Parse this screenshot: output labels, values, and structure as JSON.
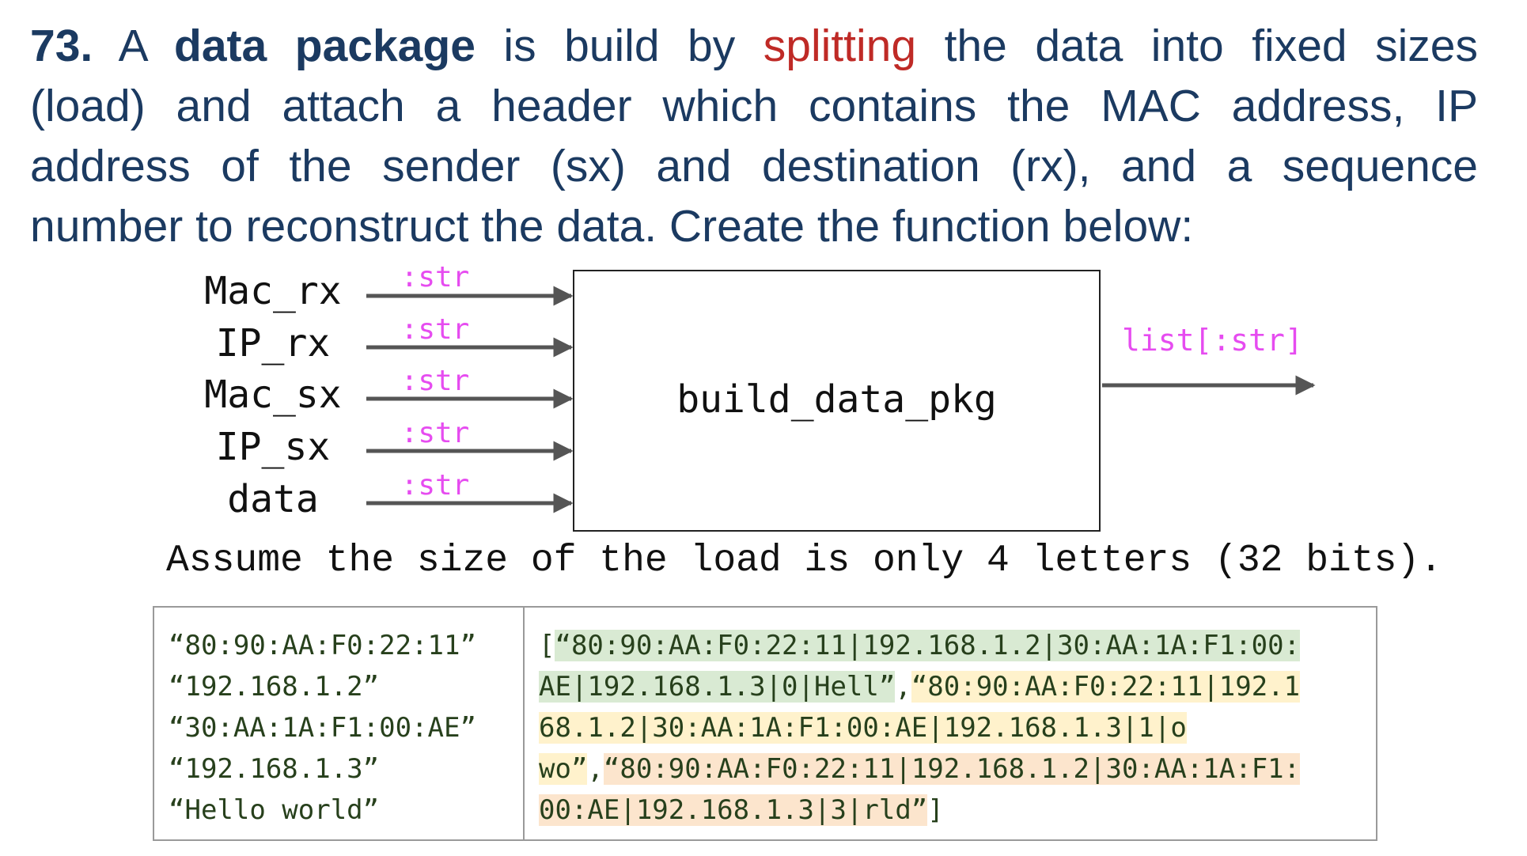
{
  "prompt": {
    "number": "73.",
    "line1_a": "A",
    "line1_bold": "data package",
    "line1_b": "is build by",
    "line1_highlight": "splitting",
    "line1_c": "the data into fixed sizes",
    "line2": "(load) and attach a header which contains the MAC address, IP",
    "line3": "address of the sender (sx) and destination (rx), and a sequence",
    "line4": "number to reconstruct the data. Create the function below:"
  },
  "diagram": {
    "inputs": [
      {
        "name": "Mac_rx",
        "type": ":str"
      },
      {
        "name": "IP_rx",
        "type": ":str"
      },
      {
        "name": "Mac_sx",
        "type": ":str"
      },
      {
        "name": "IP_sx",
        "type": ":str"
      },
      {
        "name": "data",
        "type": ":str"
      }
    ],
    "function_name": "build_data_pkg",
    "output_type": "list[:str]"
  },
  "note": "Assume the size of the load is only 4 letters (32 bits).",
  "example": {
    "inputs": [
      "“80:90:AA:F0:22:11”",
      "“192.168.1.2”",
      "“30:AA:1A:F1:00:AE”",
      "“192.168.1.3”",
      "“Hello world”"
    ],
    "output": {
      "l1_pre": "[",
      "l1_g": "“80:90:AA:F0:22:11|192.168.1.2|30:AA:1A:F1:00:",
      "l2_g": "AE|192.168.1.3|0|Hell”",
      "l2_sep": ",",
      "l2_y": "“80:90:AA:F0:22:11|192.1",
      "l3_y": "68.1.2|30:AA:1A:F1:00:AE|192.168.1.3|1|o",
      "l4_y": "wo”",
      "l4_sep": ",",
      "l4_o": "“80:90:AA:F0:22:11|192.168.1.2|30:AA:1A:F1:",
      "l5_o": "00:AE|192.168.1.3|3|rld”",
      "l5_post": "]"
    },
    "colors": {
      "pkg0": "#d9ead3",
      "pkg1": "#fff2cc",
      "pkg2": "#fce5cd"
    }
  }
}
